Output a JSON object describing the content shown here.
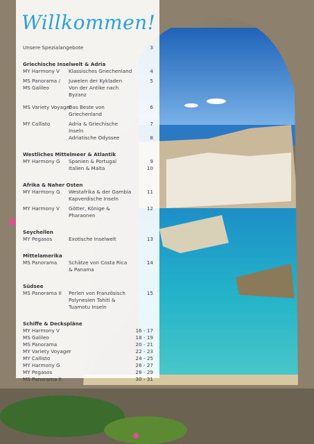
{
  "title": "Willkommen!",
  "intro": {
    "label": "Unsere Spezialangebote",
    "page": "3"
  },
  "sections": [
    {
      "heading": "Griechische Inselwelt & Adria",
      "rows": [
        {
          "ship": "MY Harmony V",
          "desc": "Klassisches Griechenland",
          "page": "4"
        },
        {
          "ship": "MS Panorama /",
          "desc": "Juwelen der Kykladen",
          "page": "5"
        },
        {
          "ship": "MS Galileo",
          "desc": "Von der Antike nach Byzanz",
          "page": ""
        },
        {
          "ship": "MS Variety Voyager",
          "desc": "Das Beste von Griechenland",
          "page": "6"
        },
        {
          "ship": "MY Callisto",
          "desc": "Adria & Griechische Inseln",
          "page": "7"
        },
        {
          "ship": "",
          "desc": "Adriatische Odyssee",
          "page": "8"
        }
      ]
    },
    {
      "heading": "Westliches Mittelmeer & Atlantik",
      "rows": [
        {
          "ship": "MY Harmony G",
          "desc": "Spanien & Portugal",
          "page": "9"
        },
        {
          "ship": "",
          "desc": "Italien & Malta",
          "page": "10"
        }
      ]
    },
    {
      "heading": "Afrika & Naher Osten",
      "rows": [
        {
          "ship": "MY Harmony G",
          "desc": "Westafrika & der Gambia Kapverdische Inseln",
          "page": "11"
        },
        {
          "ship": "MY Harmony V",
          "desc": "Götter, Könige & Pharaonen",
          "page": "12"
        }
      ]
    },
    {
      "heading": "Seychellen",
      "rows": [
        {
          "ship": "MY Pegasos",
          "desc": "Exotische Inselwelt",
          "page": "13"
        }
      ]
    },
    {
      "heading": "Mittelamerika",
      "rows": [
        {
          "ship": "MS Panorama",
          "desc": "Schätze von Costa Rica & Panama",
          "page": "14"
        }
      ]
    },
    {
      "heading": "Südsee",
      "rows": [
        {
          "ship": "MS Panorama II",
          "desc": "Perlen von Französisch Polynesien Tahiti & Tuamotu Inseln",
          "page": "15"
        }
      ]
    }
  ],
  "plans": {
    "heading": "Schiffe & Deckspläne",
    "rows": [
      {
        "ship": "MY Harmony V",
        "page": "16 - 17"
      },
      {
        "ship": "MS Galileo",
        "page": "18 - 19"
      },
      {
        "ship": "MS Panorama",
        "page": "20 - 21"
      },
      {
        "ship": "MY Variety Voyager",
        "page": "22 - 23"
      },
      {
        "ship": "MY Callisto",
        "page": "24 - 25"
      },
      {
        "ship": "MY Harmony G",
        "page": "26 - 27"
      },
      {
        "ship": "MY Pegasos",
        "page": "28 - 29"
      },
      {
        "ship": "MS Panorama II",
        "page": "30 - 31"
      }
    ]
  }
}
